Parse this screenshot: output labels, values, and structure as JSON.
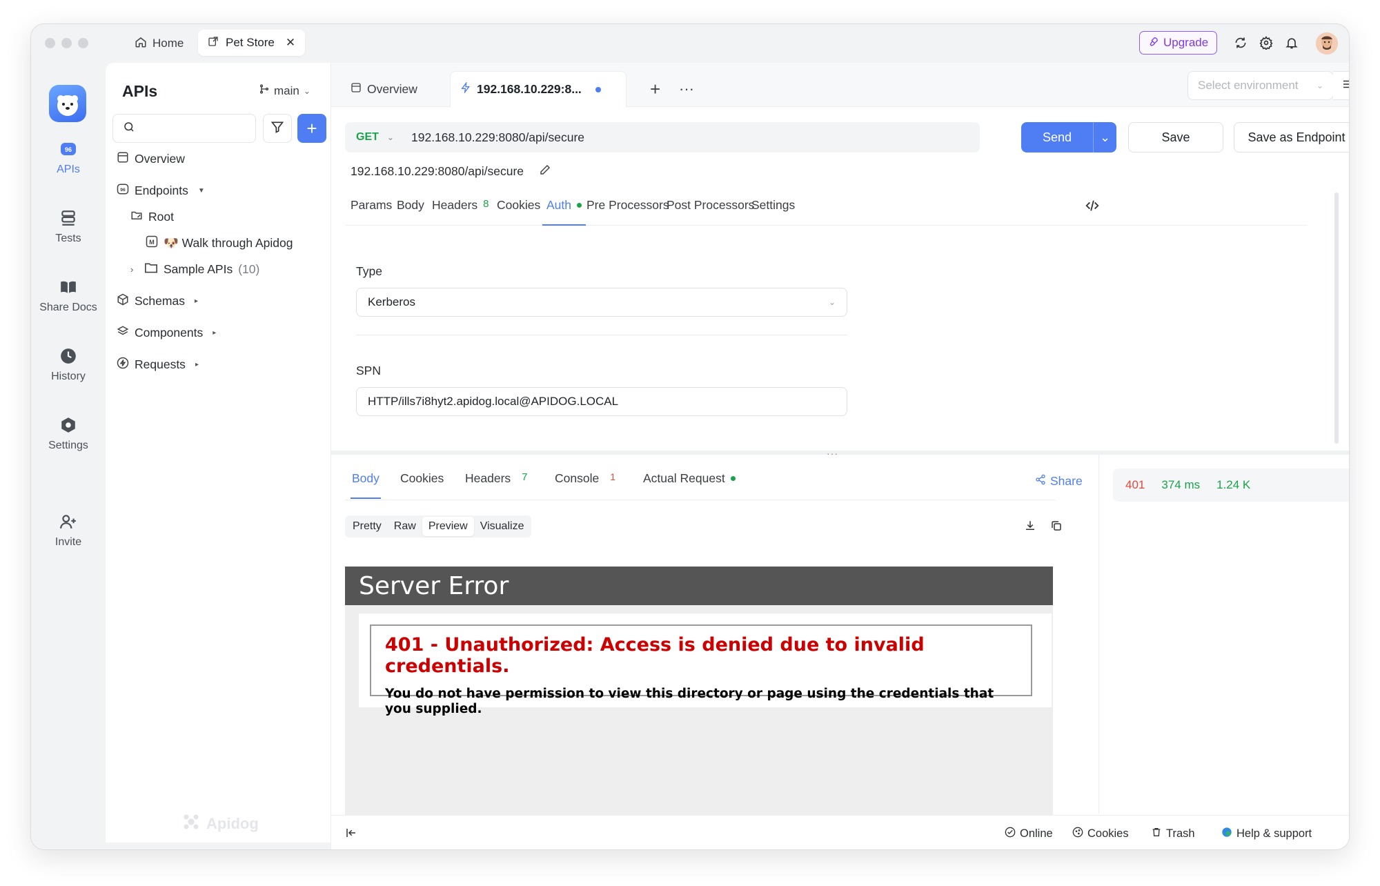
{
  "titlebar": {
    "tabs": [
      {
        "label": "Home",
        "icon": "home-icon"
      },
      {
        "label": "Pet Store",
        "icon": "external-link-icon",
        "closable": true
      }
    ],
    "upgrade_label": "Upgrade",
    "icons": [
      "refresh-icon",
      "gear-icon",
      "bell-icon"
    ]
  },
  "rail": {
    "items": [
      {
        "label": "APIs",
        "icon": "api-icon",
        "active": true
      },
      {
        "label": "Tests",
        "icon": "tests-icon"
      },
      {
        "label": "Share Docs",
        "icon": "book-icon"
      },
      {
        "label": "History",
        "icon": "clock-icon"
      },
      {
        "label": "Settings",
        "icon": "hexagon-gear-icon"
      },
      {
        "label": "Invite",
        "icon": "user-plus-icon"
      }
    ]
  },
  "sidebar": {
    "title": "APIs",
    "branch": "main",
    "search_placeholder": "",
    "tree": {
      "overview": "Overview",
      "endpoints": "Endpoints",
      "root": "Root",
      "walkthrough": "🐶 Walk through Apidog",
      "sample_apis": "Sample APIs",
      "sample_count": "(10)",
      "schemas": "Schemas",
      "components": "Components",
      "requests": "Requests"
    },
    "watermark": "Apidog"
  },
  "main": {
    "tabs": [
      {
        "label": "Overview"
      },
      {
        "label": "192.168.10.229:8...",
        "active": true,
        "unsaved": true
      }
    ],
    "env_placeholder": "Select environment",
    "method": "GET",
    "url": "192.168.10.229:8080/api/secure",
    "url_name": "192.168.10.229:8080/api/secure",
    "send_label": "Send",
    "save_label": "Save",
    "save_endpoint_label": "Save as Endpoint",
    "request_tabs": {
      "params": "Params",
      "body": "Body",
      "headers": "Headers",
      "headers_count": "8",
      "cookies": "Cookies",
      "auth": "Auth",
      "pre": "Pre Processors",
      "post": "Post Processors",
      "settings": "Settings"
    },
    "auth": {
      "type_label": "Type",
      "type_value": "Kerberos",
      "spn_label": "SPN",
      "spn_value": "HTTP/ills7i8hyt2.apidog.local@APIDOG.LOCAL"
    }
  },
  "response": {
    "tabs": {
      "body": "Body",
      "cookies": "Cookies",
      "headers": "Headers",
      "headers_count": "7",
      "console": "Console",
      "console_count": "1",
      "actual": "Actual Request"
    },
    "share_label": "Share",
    "views": [
      "Pretty",
      "Raw",
      "Preview",
      "Visualize"
    ],
    "active_view": "Preview",
    "preview": {
      "header": "Server Error",
      "title": "401 - Unauthorized: Access is denied due to invalid credentials.",
      "message": "You do not have permission to view this directory or page using the credentials that you supplied."
    },
    "meta": {
      "status": "401",
      "time": "374 ms",
      "size": "1.24 K"
    }
  },
  "statusbar": {
    "online": "Online",
    "cookies": "Cookies",
    "trash": "Trash",
    "help": "Help & support"
  },
  "colors": {
    "accent": "#4f7df3",
    "get_method": "#1aa34a",
    "error": "#cc0000",
    "status_error": "#e04a3b",
    "upgrade": "#7c3aed"
  }
}
